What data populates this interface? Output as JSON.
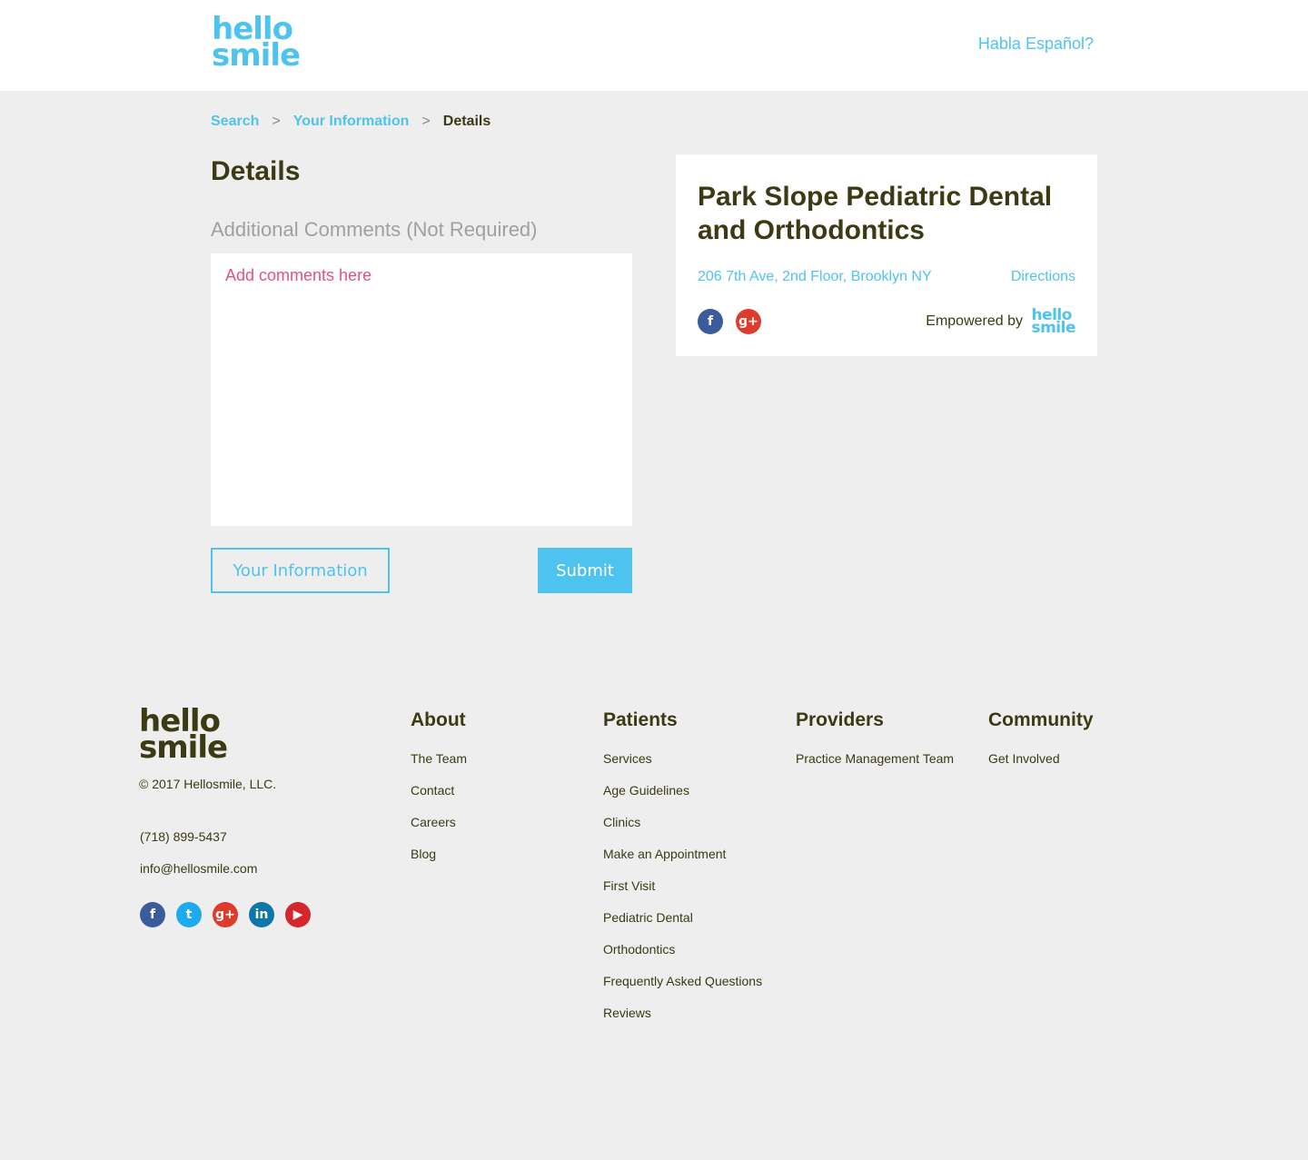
{
  "header": {
    "logo_line1": "hello",
    "logo_line2": "smile",
    "lang_link": "Habla Español?"
  },
  "breadcrumb": {
    "items": [
      "Search",
      "Your Information",
      "Details"
    ],
    "separator": ">"
  },
  "main": {
    "title": "Details",
    "comments_label": "Additional Comments (Not Required)",
    "comments_placeholder": "Add comments here",
    "back_button": "Your Information",
    "submit_button": "Submit"
  },
  "card": {
    "title": "Park Slope Pediatric Dental and Orthodontics",
    "address": "206 7th Ave, 2nd Floor, Brooklyn NY",
    "directions": "Directions",
    "empowered_by": "Empowered by",
    "social": [
      "facebook-icon",
      "google-plus-icon"
    ]
  },
  "footer": {
    "logo_line1": "hello",
    "logo_line2": "smile",
    "copyright": "© 2017 Hellosmile, LLC.",
    "phone": "(718) 899-5437",
    "email": "info@hellosmile.com",
    "social": [
      "facebook-icon",
      "twitter-icon",
      "google-plus-icon",
      "linkedin-icon",
      "youtube-icon"
    ],
    "columns": [
      {
        "heading": "About",
        "links": [
          "The Team",
          "Contact",
          "Careers",
          "Blog"
        ]
      },
      {
        "heading": "Patients",
        "links": [
          "Services",
          "Age Guidelines",
          "Clinics",
          "Make an Appointment",
          "First Visit",
          "Pediatric Dental",
          "Orthodontics",
          "Frequently Asked Questions",
          "Reviews"
        ]
      },
      {
        "heading": "Providers",
        "links": [
          "Practice Management Team"
        ]
      },
      {
        "heading": "Community",
        "links": [
          "Get Involved"
        ]
      }
    ]
  },
  "colors": {
    "accent": "#4fc3ef",
    "text_dark": "#3b3a12",
    "placeholder_pink": "#e2508a",
    "background": "#eeeeee"
  }
}
